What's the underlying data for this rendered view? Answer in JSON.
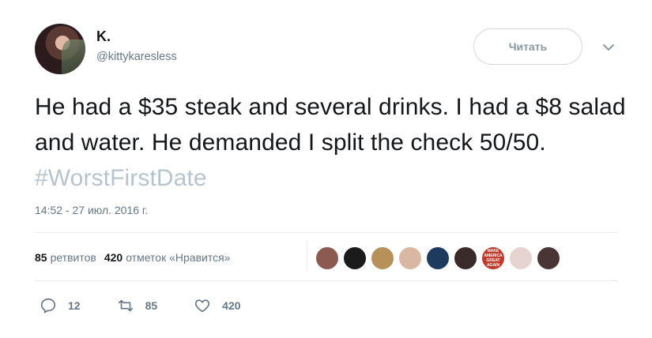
{
  "author": {
    "name": "K.",
    "handle": "@kittykaresless"
  },
  "follow_button": {
    "label": "Читать"
  },
  "tweet": {
    "text": "He had a $35 steak and several drinks. I had a $8 salad and water. He demanded I split the check 50/50. ",
    "hashtag": "#WorstFirstDate",
    "timestamp": "14:52 - 27 июл. 2016 г."
  },
  "stats": {
    "retweets_count": "85",
    "retweets_label": "ретвитов",
    "likes_count": "420",
    "likes_label": "отметок «Нравится»"
  },
  "liker_avatars": [
    {
      "color": "#8c5a50",
      "icon": "user-avatar"
    },
    {
      "color": "#1b1b1b",
      "icon": "user-avatar"
    },
    {
      "color": "#b8905a",
      "icon": "user-avatar"
    },
    {
      "color": "#d9b7a3",
      "icon": "user-avatar"
    },
    {
      "color": "#1e3a5f",
      "icon": "user-avatar"
    },
    {
      "color": "#3a2a2a",
      "icon": "user-avatar"
    },
    {
      "color": "#c0392b",
      "icon": "user-avatar",
      "text": "MAKE AMERICA GREAT AGAIN"
    },
    {
      "color": "#e5d4cf",
      "icon": "user-avatar"
    },
    {
      "color": "#4a3535",
      "icon": "user-avatar"
    }
  ],
  "actions": {
    "reply_count": "12",
    "retweet_count": "85",
    "like_count": "420"
  },
  "colors": {
    "hashtag": "#b7c4cd",
    "secondary_text": "#657786",
    "primary_text": "#14171a"
  }
}
